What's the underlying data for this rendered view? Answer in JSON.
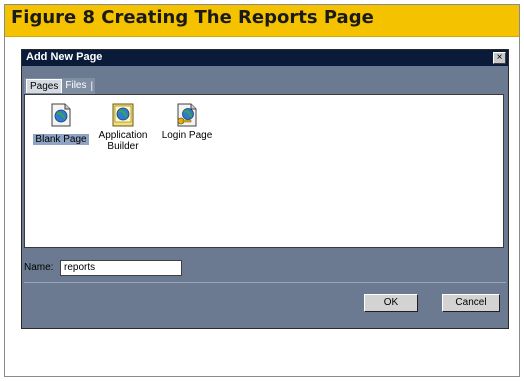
{
  "caption": "Figure 8 Creating The Reports Page",
  "dialog": {
    "title": "Add New Page",
    "close_label": "×",
    "tabs": [
      {
        "label": "Pages",
        "active": true
      },
      {
        "label": "Files",
        "active": false
      }
    ],
    "tab_separator": "|",
    "items": [
      {
        "label": "Blank Page",
        "icon": "blank-page-icon",
        "selected": true
      },
      {
        "label": "Application Builder",
        "icon": "application-builder-icon",
        "selected": false
      },
      {
        "label": "Login Page",
        "icon": "login-page-icon",
        "selected": false
      }
    ],
    "name_label": "Name:",
    "name_value": "reports",
    "ok_label": "OK",
    "cancel_label": "Cancel"
  },
  "colors": {
    "caption_bg": "#f5c200",
    "dialog_bg": "#6b7a90",
    "titlebar_bg": "#0a1b3a",
    "selection": "#8fa3c2"
  }
}
